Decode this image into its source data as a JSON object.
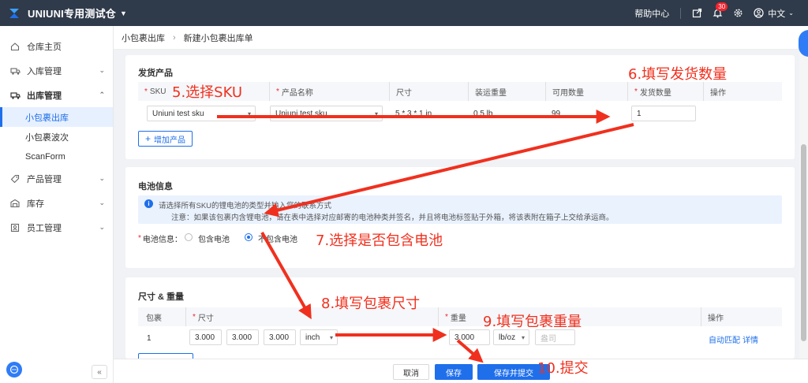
{
  "header": {
    "brand": "UNIUNI专用测试仓",
    "help": "帮助中心",
    "badge_count": "30",
    "language": "中文"
  },
  "sidebar": {
    "items": [
      {
        "label": "仓库主页",
        "icon": "home-icon"
      },
      {
        "label": "入库管理",
        "icon": "truck-in-icon"
      },
      {
        "label": "出库管理",
        "icon": "truck-out-icon"
      },
      {
        "label": "产品管理",
        "icon": "tag-icon"
      },
      {
        "label": "库存",
        "icon": "warehouse-icon"
      },
      {
        "label": "员工管理",
        "icon": "staff-icon"
      }
    ],
    "sub_items": [
      "小包裹出库",
      "小包裹波次",
      "ScanForm"
    ]
  },
  "breadcrumb": [
    "小包裹出库",
    "新建小包裹出库单"
  ],
  "product_section": {
    "title": "发货产品",
    "columns": [
      "SKU",
      "产品名称",
      "尺寸",
      "装运重量",
      "可用数量",
      "发货数量",
      "操作"
    ],
    "row": {
      "sku": "Uniuni test sku",
      "name": "Uniuni test sku",
      "size": "5 * 3 * 1 in",
      "weight": "0.5 lb",
      "available": "99",
      "quantity": "1"
    },
    "add_button": "增加产品"
  },
  "battery_section": {
    "title": "电池信息",
    "info_line1": "请选择所有SKU的锂电池的类型并输入您的联系方式",
    "info_line2": "注意：如果该包裹内含锂电池，请在表中选择对应邮寄的电池种类并签名，并且将电池标签贴于外箱，将该表附在箱子上交给承运商。",
    "label": "电池信息：",
    "options": [
      "包含电池",
      "不包含电池"
    ],
    "selected": "不包含电池"
  },
  "dimension_section": {
    "title": "尺寸 & 重量",
    "columns": [
      "包裹",
      "尺寸",
      "重量",
      "操作"
    ],
    "row": {
      "package": "1",
      "length": "3.000",
      "width": "3.000",
      "height": "3.000",
      "size_unit": "inch",
      "weight": "3.000",
      "weight_unit": "lb/oz",
      "weight_placeholder": "盎司"
    },
    "actions": [
      "自动匹配",
      "详情"
    ]
  },
  "footer": {
    "cancel": "取消",
    "save": "保存",
    "save_submit": "保存并提交"
  },
  "annotations": [
    "5.选择SKU",
    "6.填写发货数量",
    "7.选择是否包含电池",
    "8.填写包裹尺寸",
    "9.填写包裹重量",
    "10.提交"
  ],
  "colors": {
    "primary": "#1f6feb",
    "header_bg": "#2f3a4a",
    "annotation": "#f0301e"
  }
}
